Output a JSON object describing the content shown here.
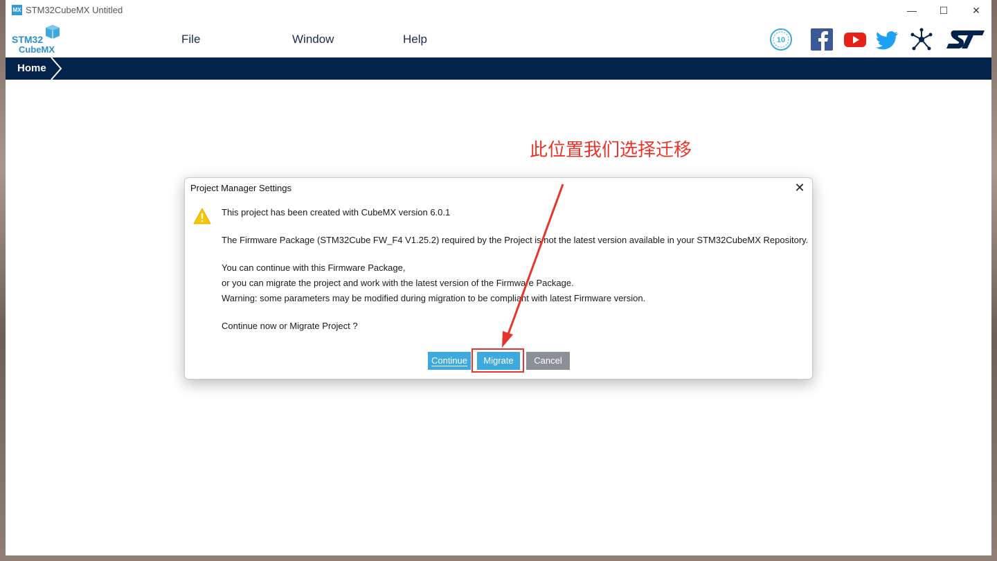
{
  "window": {
    "app_icon_text": "MX",
    "title": "STM32CubeMX Untitled",
    "controls": [
      "—",
      "☐",
      "✕"
    ]
  },
  "logo": {
    "line1": "STM32",
    "line2": "CubeMX"
  },
  "menu": [
    {
      "label": "File"
    },
    {
      "label": "Window"
    },
    {
      "label": "Help"
    }
  ],
  "social": [
    "anniversary-10-icon",
    "facebook-icon",
    "youtube-icon",
    "twitter-icon",
    "network-icon",
    "st-logo-icon"
  ],
  "breadcrumb": {
    "home": "Home"
  },
  "annotation": {
    "text": "此位置我们选择迁移",
    "color": "#e8352b"
  },
  "dialog": {
    "title": "Project Manager Settings",
    "close": "✕",
    "lines": {
      "l1": "This project has been created with CubeMX version 6.0.1",
      "l2": "The Firmware Package (STM32Cube FW_F4 V1.25.2) required by the Project is not the latest version available in your STM32CubeMX Repository.",
      "l3": "You can continue with this Firmware Package,",
      "l4": "or you can migrate the project and work with the latest version of the Firmware Package.",
      "l5": "Warning: some parameters may be modified during migration to be compliant with latest Firmware version.",
      "l6": "Continue now or Migrate Project ?"
    },
    "buttons": {
      "continue": "Continue",
      "migrate": "Migrate",
      "cancel": "Cancel"
    }
  },
  "colors": {
    "navbar": "#03234b",
    "button_blue": "#3ea9dc",
    "button_gray": "#8b9096",
    "annotation_red": "#e8352b"
  }
}
